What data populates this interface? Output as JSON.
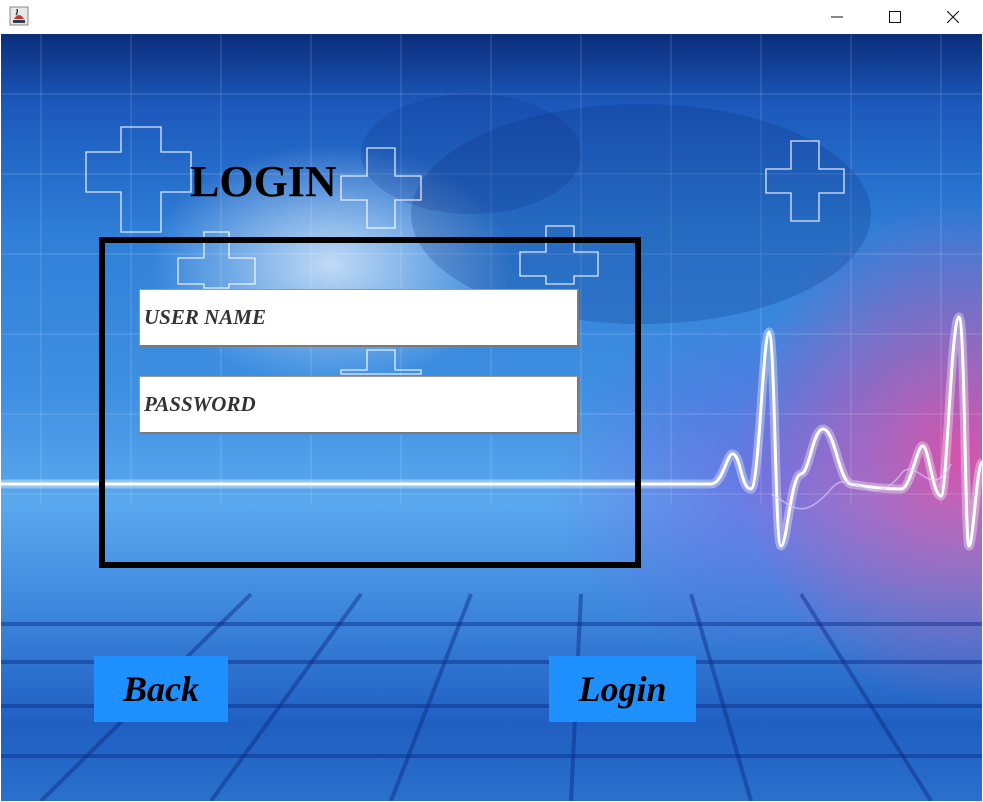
{
  "window": {
    "app_icon": "java-coffee-icon",
    "controls": {
      "minimize": "minimize-icon",
      "maximize": "maximize-icon",
      "close": "close-icon"
    }
  },
  "form": {
    "heading": "LOGIN",
    "username_placeholder": "USER NAME",
    "password_placeholder": "PASSWORD"
  },
  "buttons": {
    "back_label": "Back",
    "login_label": "Login"
  },
  "colors": {
    "button": "#1e90ff",
    "accent_glow": "#ec46a0",
    "background": "#2f7fd8"
  }
}
